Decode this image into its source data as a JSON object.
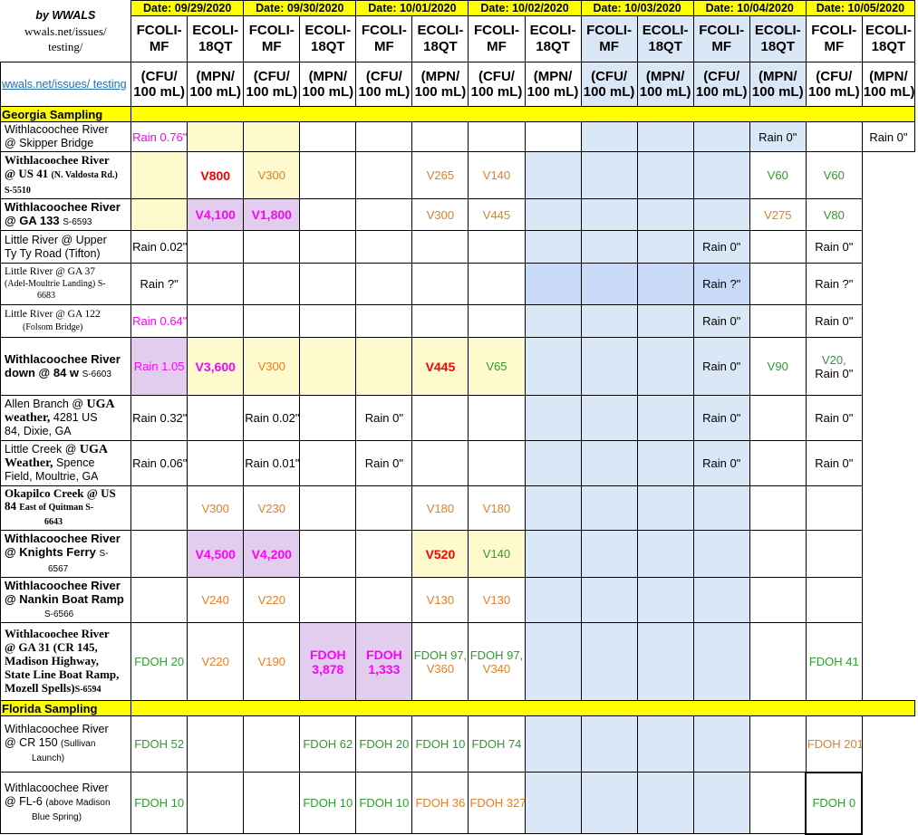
{
  "header": {
    "by": "by WWALS",
    "site": "wwals.net/issues/",
    "site2": "testing/",
    "link": "wwals.net/issues/ testing",
    "dates": [
      "Date: 09/29/2020",
      "Date: 09/30/2020",
      "Date: 10/01/2020",
      "Date: 10/02/2020",
      "Date: 10/03/2020",
      "Date: 10/04/2020",
      "Date: 10/05/2020"
    ],
    "fcoli": "FCOLI-\nMF",
    "ecoli": "ECOLI-\n18QT",
    "fcoli_l1": "FCOLI-",
    "fcoli_l2": "MF",
    "ecoli_l1": "ECOLI-",
    "ecoli_l2": "18QT",
    "cfu_l1": "(CFU/",
    "cfu_l2": "100 mL)",
    "mpn_l1": "(MPN/",
    "mpn_l2": "100 mL)"
  },
  "sections": {
    "georgia": "Georgia Sampling",
    "florida": "Florida Sampling"
  },
  "sites": {
    "s1": {
      "a": "Withlacoochee River",
      "b": "@ Skipper Bridge"
    },
    "s2": {
      "a": "Withlacoochee River",
      "b": "@ US 41",
      "c": "(N. Valdosta Rd.)",
      "d": "S-5510"
    },
    "s3": {
      "a": "Withlacoochee River",
      "b": "@ GA 133",
      "c": "S-6593"
    },
    "s4": {
      "a": "Little River @ Upper",
      "b": "Ty Ty Road (Tifton)"
    },
    "s5": {
      "a": "Little River @ GA 37",
      "b": "(Adel-Moultrie Landing) S-",
      "c": "6683"
    },
    "s6": {
      "a": "Little River @ GA 122",
      "b": "(Folsom Bridge)"
    },
    "s7": {
      "a": "Withlacoochee River",
      "b": "down @ 84 w",
      "c": "S-6603"
    },
    "s8": {
      "a": "Allen  Branch @",
      "b": "UGA",
      "c": "weather,",
      "d": "4281 US",
      "e": "84, Dixie, GA"
    },
    "s9": {
      "a": "Little Creek @",
      "b": "UGA",
      "c": "Weather,",
      "d": "Spence",
      "e": "Field, Moultrie, GA"
    },
    "s10": {
      "a": "Okapilco Creek @ US",
      "b": "84",
      "c": "East of Quitman S-",
      "d": "6643"
    },
    "s11": {
      "a": "Withlacoochee River",
      "b": "@ Knights Ferry",
      "c": "S-",
      "d": "6567"
    },
    "s12": {
      "a": "Withlacoochee River",
      "b": "@ Nankin Boat Ramp",
      "c": "S-6566"
    },
    "s13": {
      "a": "Withlacoochee River",
      "b": "@ GA 31 (CR 145,",
      "c": "Madison Highway,",
      "d": "State Line Boat Ramp,",
      "e": "Mozell Spells)",
      "f": "S-6594"
    },
    "f1": {
      "a": "Withlacoochee River",
      "b": "@ CR 150",
      "c": "(Sullivan",
      "d": "Launch)"
    },
    "f2": {
      "a": "Withlacoochee River",
      "b": "@ FL-6",
      "c": "(above Madison",
      "d": "Blue Spring)"
    }
  },
  "values": {
    "r1": {
      "c2": "Rain 0.76\"",
      "c12": "Rain 0\"",
      "c14": "Rain 0\""
    },
    "r2": {
      "c3": "V800",
      "c4": "V300",
      "c7": "V265",
      "c8": "V140",
      "c13": "V60",
      "c14": "V60"
    },
    "r3": {
      "c3": "V4,100",
      "c4": "V1,800",
      "c7": "V300",
      "c8": "V445",
      "c13": "V275",
      "c14": "V80"
    },
    "r4": {
      "c2": "Rain 0.02\"",
      "c12": "Rain 0\"",
      "c14": "Rain 0\""
    },
    "r5": {
      "c2": "Rain ?\"",
      "c12": "Rain ?\"",
      "c14": "Rain ?\""
    },
    "r6": {
      "c2": "Rain 0.64\"",
      "c12": "Rain 0\"",
      "c14": "Rain 0\""
    },
    "r7": {
      "c2": "Rain 1.05",
      "c3": "V3,600",
      "c4": "V300",
      "c7": "V445",
      "c8": "V65",
      "c12": "Rain 0\"",
      "c13": "V90",
      "c14a": "V20,",
      "c14b": "Rain 0\""
    },
    "r8": {
      "c2": "Rain 0.32\"",
      "c4": "Rain 0.02\"",
      "c6": "Rain 0\"",
      "c12": "Rain 0\"",
      "c14": "Rain 0\""
    },
    "r9": {
      "c2": "Rain 0.06\"",
      "c4": "Rain 0.01\"",
      "c6": "Rain 0\"",
      "c12": "Rain 0\"",
      "c14": "Rain 0\""
    },
    "r10": {
      "c3": "V300",
      "c4": "V230",
      "c7": "V180",
      "c8": "V180"
    },
    "r11": {
      "c3": "V4,500",
      "c4": "V4,200",
      "c7": "V520",
      "c8": "V140"
    },
    "r12": {
      "c3": "V240",
      "c4": "V220",
      "c7": "V130",
      "c8": "V130"
    },
    "r13": {
      "c2": "FDOH 20",
      "c3": "V220",
      "c4": "V190",
      "c5a": "FDOH",
      "c5b": "3,878",
      "c6a": "FDOH",
      "c6b": "1,333",
      "c7a": "FDOH 97,",
      "c7b": "V360",
      "c8a": "FDOH 97,",
      "c8b": "V340",
      "c14": "FDOH 41"
    },
    "f1": {
      "c2": "FDOH 52",
      "c5": "FDOH 62",
      "c6": "FDOH 20",
      "c7": "FDOH 10",
      "c8": "FDOH 74",
      "c14": "FDOH 201"
    },
    "f2": {
      "c2": "FDOH 10",
      "c5": "FDOH 10",
      "c6": "FDOH 10",
      "c7": "FDOH 36",
      "c8": "FDOH 327",
      "c14": "FDOH 0"
    }
  }
}
